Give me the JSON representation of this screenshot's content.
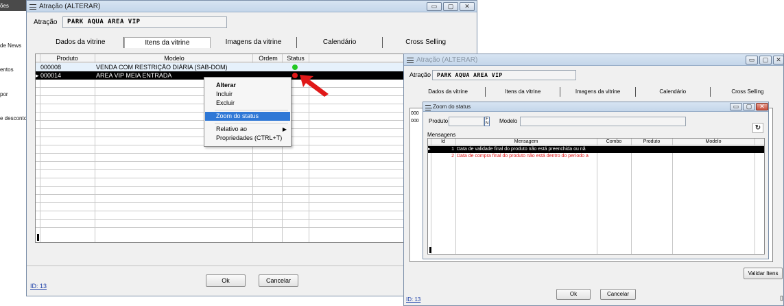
{
  "bg_sidebar": {
    "items": [
      "ões",
      "de News",
      "entos",
      "por",
      "e desconto"
    ]
  },
  "main_window": {
    "title": "Atração (ALTERAR)",
    "attraction_label": "Atração",
    "attraction_value": "PARK AQUA AREA VIP",
    "tabs": [
      "Dados da vitrine",
      "Itens da vitrine",
      "Imagens da vitrine",
      "Calendário",
      "Cross Selling"
    ],
    "grid_headers": [
      "Produto",
      "Modelo",
      "Ordem",
      "Status"
    ],
    "rows": [
      {
        "produto": "000008",
        "modelo": "VENDA COM RESTRIÇÃO DIÁRIA (SAB-DOM)",
        "ordem": "",
        "status_color": "#22c822"
      },
      {
        "produto": "000014",
        "modelo": "AREA VIP MEIA ENTRADA",
        "ordem": "",
        "status_color": "#e01818"
      }
    ],
    "id_link": "ID: 13",
    "ok_label": "Ok",
    "cancel_label": "Cancelar"
  },
  "context_menu": {
    "items": [
      "Alterar",
      "Incluir",
      "Excluir",
      "Zoom do status",
      "Relativo ao",
      "Propriedades (CTRL+T)"
    ],
    "selected": "Zoom do status"
  },
  "second_window": {
    "title": "Atração (ALTERAR)",
    "attraction_label": "Atração",
    "attraction_value": "PARK AQUA AREA VIP",
    "tabs": [
      "Dados da vitrine",
      "Itens da vitrine",
      "Imagens da vitrine",
      "Calendário",
      "Cross Selling"
    ],
    "row_prefix_1": "000",
    "row_prefix_2": "000",
    "id_link": "ID: 13",
    "ok_label": "Ok",
    "cancel_label": "Cancelar",
    "validate_label": "Validar Itens"
  },
  "zoom_dialog": {
    "title": "Zoom do status",
    "produto_label": "Produto",
    "modelo_label": "Modelo",
    "mensagens_label": "Mensagens",
    "headers": [
      "Id",
      "Mensagem",
      "Combo",
      "Produto",
      "Modelo"
    ],
    "rows": [
      {
        "id": "1",
        "mensagem": "Data de validade final do produto não está preenchida ou nã"
      },
      {
        "id": "2",
        "mensagem": "Data de compra final do produto não está dentro do período a"
      }
    ]
  },
  "colors": {
    "accent": "#2f78d6",
    "error_text": "#e01818",
    "arrow": "#e01818"
  }
}
